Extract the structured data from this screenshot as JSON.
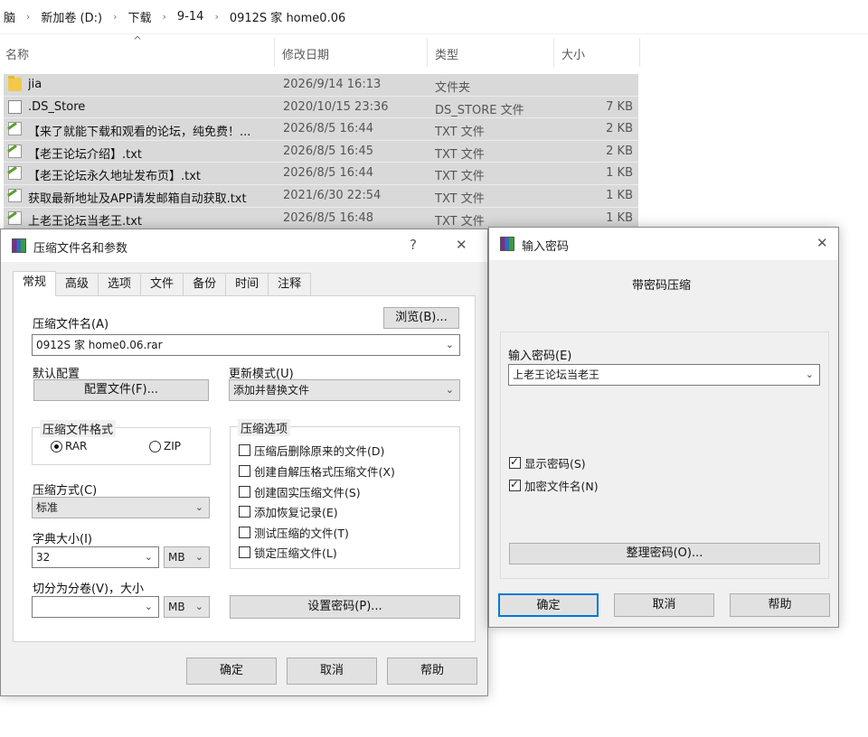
{
  "breadcrumb": [
    "脑",
    "新加卷 (D:)",
    "下载",
    "9-14",
    "0912S 家 home0.06"
  ],
  "columns": {
    "name": "名称",
    "date": "修改日期",
    "type": "类型",
    "size": "大小"
  },
  "files": [
    {
      "icon": "folder-icon",
      "name": "jia",
      "date": "2026/9/14 16:13",
      "type": "文件夹",
      "size": ""
    },
    {
      "icon": "file-icon",
      "name": ".DS_Store",
      "date": "2020/10/15 23:36",
      "type": "DS_STORE 文件",
      "size": "7 KB"
    },
    {
      "icon": "txt-file-icon",
      "name": "【来了就能下载和观看的论坛，纯免费！...",
      "date": "2026/8/5 16:44",
      "type": "TXT 文件",
      "size": "2 KB"
    },
    {
      "icon": "txt-file-icon",
      "name": "【老王论坛介绍】.txt",
      "date": "2026/8/5 16:45",
      "type": "TXT 文件",
      "size": "2 KB"
    },
    {
      "icon": "txt-file-icon",
      "name": "【老王论坛永久地址发布页】.txt",
      "date": "2026/8/5 16:44",
      "type": "TXT 文件",
      "size": "1 KB"
    },
    {
      "icon": "txt-file-icon",
      "name": "获取最新地址及APP请发邮箱自动获取.txt",
      "date": "2021/6/30 22:54",
      "type": "TXT 文件",
      "size": "1 KB"
    },
    {
      "icon": "txt-file-icon",
      "name": "上老王论坛当老王.txt",
      "date": "2026/8/5 16:48",
      "type": "TXT 文件",
      "size": "1 KB"
    }
  ],
  "archive_dialog": {
    "title": "压缩文件名和参数",
    "help": "?",
    "close": "✕",
    "tabs": [
      "常规",
      "高级",
      "选项",
      "文件",
      "备份",
      "时间",
      "注释"
    ],
    "archive_name_label": "压缩文件名(A)",
    "browse_button": "浏览(B)...",
    "archive_name_value": "0912S 家 home0.06.rar",
    "default_profile_label": "默认配置",
    "profile_button": "配置文件(F)...",
    "update_mode_label": "更新模式(U)",
    "update_mode_value": "添加并替换文件",
    "format_group": "压缩文件格式",
    "format_rar": "RAR",
    "format_zip": "ZIP",
    "options_group": "压缩选项",
    "options": [
      "压缩后删除原来的文件(D)",
      "创建自解压格式压缩文件(X)",
      "创建固实压缩文件(S)",
      "添加恢复记录(E)",
      "测试压缩的文件(T)",
      "锁定压缩文件(L)"
    ],
    "method_label": "压缩方式(C)",
    "method_value": "标准",
    "dict_label": "字典大小(I)",
    "dict_value": "32",
    "dict_unit": "MB",
    "split_label": "切分为分卷(V)，大小",
    "split_value": "",
    "split_unit": "MB",
    "set_password_button": "设置密码(P)...",
    "ok": "确定",
    "cancel": "取消",
    "help_button": "帮助"
  },
  "password_dialog": {
    "title": "输入密码",
    "close": "✕",
    "heading": "带密码压缩",
    "password_label": "输入密码(E)",
    "password_value": "上老王论坛当老王",
    "show_password": "显示密码(S)",
    "encrypt_names": "加密文件名(N)",
    "organize_button": "整理密码(O)...",
    "ok": "确定",
    "cancel": "取消",
    "help_button": "帮助"
  }
}
